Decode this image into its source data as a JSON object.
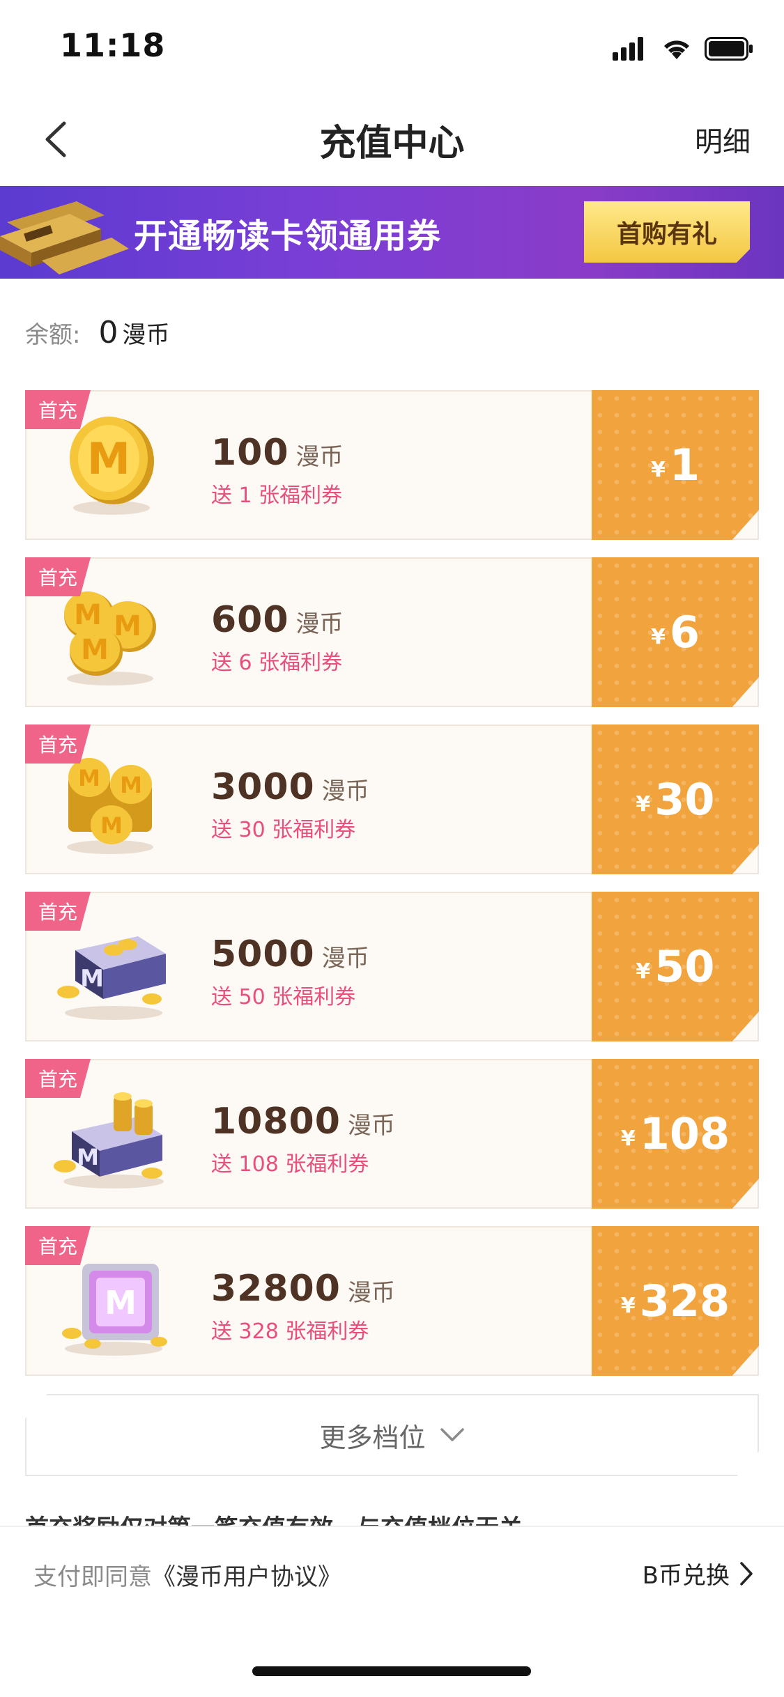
{
  "status_bar": {
    "time": "11:18"
  },
  "nav": {
    "title": "充值中心",
    "detail_label": "明细"
  },
  "banner": {
    "text": "开通畅读卡领通用券",
    "button_label": "首购有礼"
  },
  "balance": {
    "label": "余额:",
    "value": "0",
    "unit": "漫币"
  },
  "tiers": [
    {
      "badge": "首充",
      "coins": "100",
      "unit": "漫币",
      "gift": "送 1 张福利券",
      "currency": "¥",
      "price": "1"
    },
    {
      "badge": "首充",
      "coins": "600",
      "unit": "漫币",
      "gift": "送 6 张福利券",
      "currency": "¥",
      "price": "6"
    },
    {
      "badge": "首充",
      "coins": "3000",
      "unit": "漫币",
      "gift": "送 30 张福利券",
      "currency": "¥",
      "price": "30"
    },
    {
      "badge": "首充",
      "coins": "5000",
      "unit": "漫币",
      "gift": "送 50 张福利券",
      "currency": "¥",
      "price": "50"
    },
    {
      "badge": "首充",
      "coins": "10800",
      "unit": "漫币",
      "gift": "送 108 张福利券",
      "currency": "¥",
      "price": "108"
    },
    {
      "badge": "首充",
      "coins": "32800",
      "unit": "漫币",
      "gift": "送 328 张福利券",
      "currency": "¥",
      "price": "328"
    }
  ],
  "more": {
    "label": "更多档位"
  },
  "notice": "首充奖励仅对第一笔充值有效，与充值档位无关",
  "footer": {
    "agreement_prefix": "支付即同意",
    "agreement_link": "《漫币用户协议》",
    "bcoin_label": "B币兑换"
  },
  "colors": {
    "accent_orange": "#f1a43e",
    "badge_pink": "#f0648a",
    "gift_pink": "#ea4f7b",
    "banner_purple": "#7a3ed6"
  }
}
